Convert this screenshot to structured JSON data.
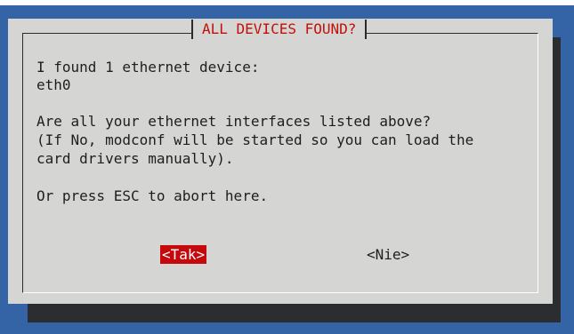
{
  "dialog": {
    "title": "ALL DEVICES FOUND?",
    "lines": [
      "I found 1 ethernet device:",
      "eth0",
      "Are all your ethernet interfaces listed above?",
      "(If No, modconf will be started so you can load the",
      "card drivers manually).",
      "Or press ESC to abort here."
    ],
    "buttons": {
      "yes": "<Tak>",
      "no": "<Nie>"
    }
  },
  "colors": {
    "background": "#3463a6",
    "dialog": "#d5d5d3",
    "title_text": "#c2100a",
    "selected_button": "#c4080b"
  }
}
